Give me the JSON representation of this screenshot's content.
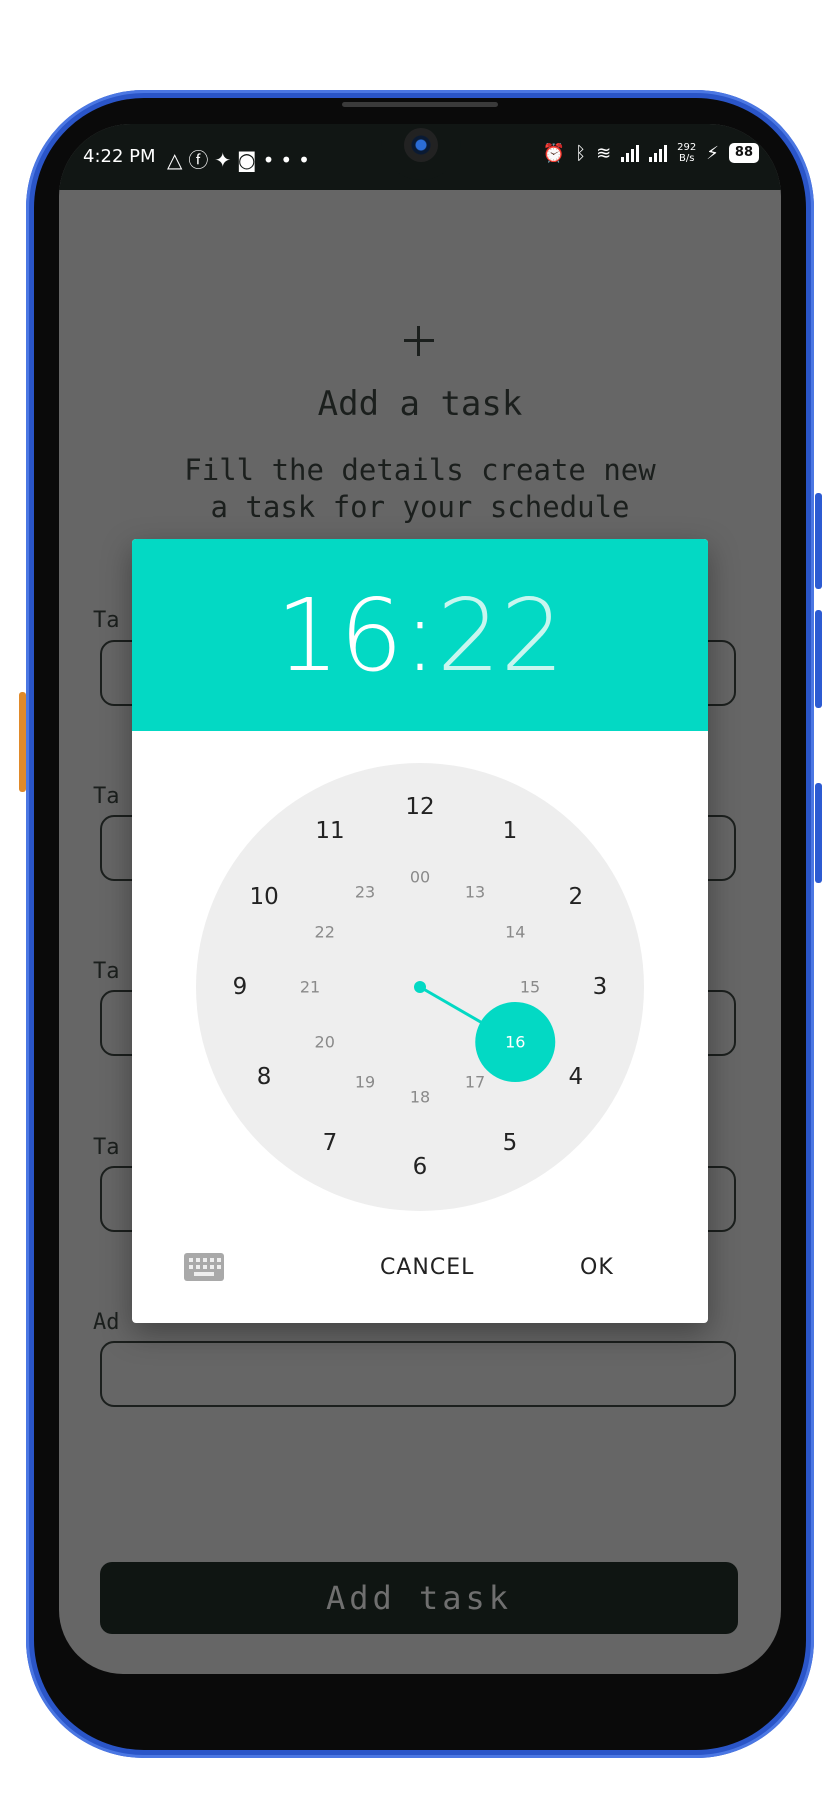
{
  "status_bar": {
    "time": "4:22 PM",
    "left_icons": [
      "app-icon",
      "facebook-icon",
      "twitter-icon",
      "instagram-icon",
      "more-icon"
    ],
    "net_speed_value": "292",
    "net_speed_unit": "B/s",
    "battery": "88"
  },
  "form": {
    "title": "Add a task",
    "subtitle": "Fill the details create new a task for your schedule",
    "field_labels": [
      "Ta",
      "Ta",
      "Ta",
      "Ta",
      "Ad"
    ],
    "submit_label": "Add task"
  },
  "time_picker": {
    "hour": "16",
    "separator": ":",
    "minute": "22",
    "outer_hours": [
      "12",
      "1",
      "2",
      "3",
      "4",
      "5",
      "6",
      "7",
      "8",
      "9",
      "10",
      "11"
    ],
    "inner_hours": [
      "00",
      "13",
      "14",
      "15",
      "16",
      "17",
      "18",
      "19",
      "20",
      "21",
      "22",
      "23"
    ],
    "selected_hour": "16",
    "cancel_label": "CANCEL",
    "ok_label": "OK",
    "accent_color": "#03d9c4"
  },
  "colors": {
    "overlay": "#666666",
    "frame": "#2a55c8"
  }
}
